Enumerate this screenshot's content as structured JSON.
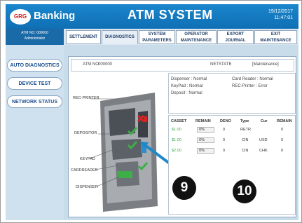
{
  "header": {
    "logo": "GRG",
    "brand": "Banking",
    "title": "ATM SYSTEM",
    "date": "19/12/2017",
    "time": "11:47:01"
  },
  "left_info": {
    "atm_no": "ATM NO: 000000",
    "user": "Administrator"
  },
  "tabs": [
    {
      "label": "SETTLEMENT",
      "label2": ""
    },
    {
      "label": "DIAGNOSTICS",
      "label2": ""
    },
    {
      "label": "SYSTEM",
      "label2": "PARAMETERS"
    },
    {
      "label": "OPERATOR",
      "label2": "MAINTENANCE"
    },
    {
      "label": "EXPORT",
      "label2": "JOURNAL"
    },
    {
      "label": "EXIT",
      "label2": "MAINTENANCE"
    }
  ],
  "sidebar": {
    "items": [
      "AUTO DIAGNOSTICS",
      "DEVICE TEST",
      "NETWORK STATUS"
    ]
  },
  "atm_bar": {
    "atm_no_label": "ATM NO.",
    "atm_no": "000000",
    "netstate_label": "NETSTATE",
    "netstate": "[Maintenance]"
  },
  "status": {
    "dispenser": "Dispenser : Normal",
    "card_reader": "Card Reader : Normal",
    "keypad": "KeyPad : Normal",
    "rec_printer": "REC-Printer : Error",
    "deposit": "Deposit : Normal"
  },
  "diagram_labels": {
    "rec_printer": "REC-PRINTER",
    "depositor": "DEPOSITOR",
    "keypad": "KEYPAD",
    "cardreader": "CARDREADER",
    "dispenser": "DISPENSER"
  },
  "table": {
    "headers": [
      "CASSET",
      "REMAIN",
      "DENO",
      "Type",
      "Cur",
      "REMAIN"
    ],
    "rows": [
      {
        "casset": "$1.00",
        "remain": "0%",
        "deno": "0",
        "type": "RETR",
        "cur": "",
        "remain2": "0"
      },
      {
        "casset": "$1.00",
        "remain": "0%",
        "deno": "0",
        "type": "CIN",
        "cur": "USD",
        "remain2": "0"
      },
      {
        "casset": "$2.00",
        "remain": "0%",
        "deno": "0",
        "type": "CIN",
        "cur": "CHK",
        "remain2": "0"
      }
    ]
  },
  "callouts": {
    "first": "9",
    "second": "10"
  },
  "colors": {
    "header_blue": "#1b86cc",
    "arrow_blue": "#1f88c9",
    "check_green": "#3fae49",
    "error_red": "#d62424"
  }
}
